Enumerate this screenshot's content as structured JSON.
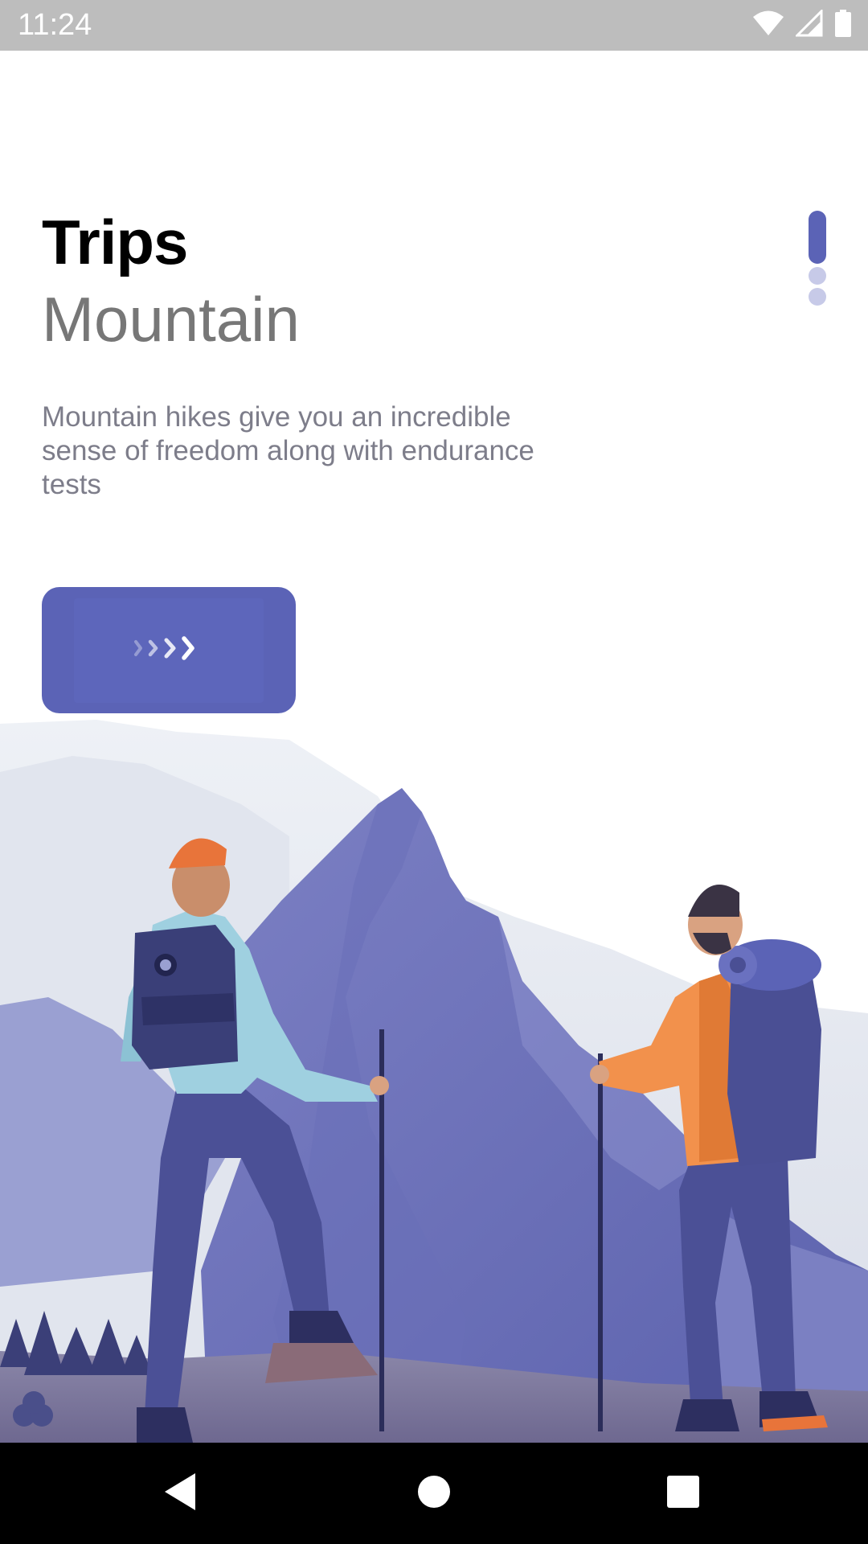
{
  "status_bar": {
    "time": "11:24",
    "icons": [
      "wifi-icon",
      "signal-icon",
      "battery-icon"
    ]
  },
  "content": {
    "title": "Trips",
    "subtitle": "Mountain",
    "description": "Mountain hikes give you an incredible sense of freedom along with endurance tests"
  },
  "pager": {
    "total": 3,
    "active_index": 0
  },
  "next_button": {
    "icon": "chevrons-right-icon"
  },
  "illustration": {
    "name": "hikers-mountain-illustration"
  },
  "nav_bar": {
    "icons": [
      "back-icon",
      "home-icon",
      "recents-icon"
    ]
  },
  "colors": {
    "accent": "#5b63b6",
    "accent_light": "#c7cae8",
    "title": "#000000",
    "subtitle": "#777777",
    "description": "#7d7d8a",
    "status_bar": "#bdbdbd",
    "nav_bar": "#000000"
  }
}
